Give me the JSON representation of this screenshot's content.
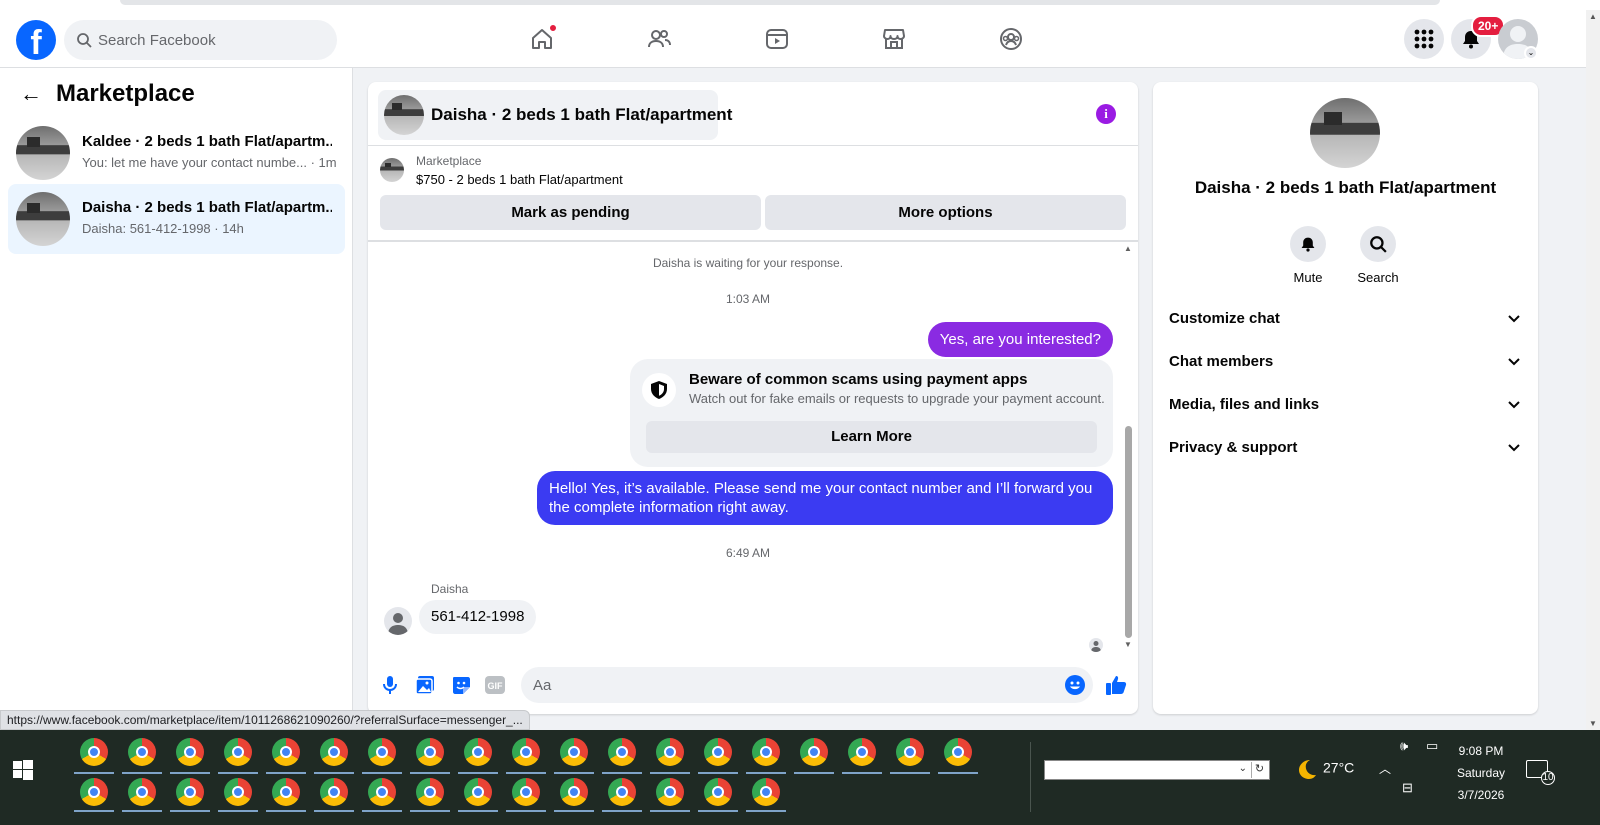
{
  "header": {
    "search_placeholder": "Search Facebook",
    "nav": [
      "home-icon",
      "friends-icon",
      "video-icon",
      "marketplace-icon",
      "groups-icon"
    ],
    "notifications_badge": "20+",
    "colors": {
      "brand": "#0866ff",
      "badge": "#e41e3f"
    }
  },
  "sidebar": {
    "title": "Marketplace",
    "conversations": [
      {
        "name": "Kaldee · 2 beds 1 bath Flat/apartm...",
        "preview": "You: let me have your contact numbe... · 1m"
      },
      {
        "name": "Daisha · 2 beds 1 bath Flat/apartm...",
        "preview": "Daisha: 561-412-1998 · 14h"
      }
    ]
  },
  "chat": {
    "title": "Daisha · 2 beds 1 bath Flat/apartment",
    "listing_source": "Marketplace",
    "listing_price": "$750 - 2 beds 1 bath Flat/apartment",
    "mark_pending_label": "Mark as pending",
    "more_options_label": "More options",
    "waiting_text": "Daisha is waiting for your response.",
    "time_1": "1:03 AM",
    "msg_out_1": "Yes, are you interested?",
    "scam_title": "Beware of common scams using payment apps",
    "scam_desc": "Watch out for fake emails or requests to upgrade your payment account.",
    "learn_more": "Learn More",
    "msg_out_2": "Hello! Yes, it’s available. Please send me your contact number and I’ll forward you the complete information right away.",
    "time_2": "6:49 AM",
    "sender_name": "Daisha",
    "msg_in_1": "561-412-1998",
    "composer_placeholder": "Aa",
    "colors": {
      "outgoing_purple": "#8a2be2",
      "outgoing_blue": "#3b3bf2",
      "accent": "#0866ff"
    }
  },
  "details": {
    "title": "Daisha · 2 beds 1 bath Flat/apartment",
    "mute_label": "Mute",
    "search_label": "Search",
    "sections": [
      "Customize chat",
      "Chat members",
      "Media, files and links",
      "Privacy & support"
    ]
  },
  "status_url": "https://www.facebook.com/marketplace/item/1011268621090260/?referralSurface=messenger_...",
  "taskbar": {
    "temperature": "27°C",
    "time": "9:08 PM",
    "day": "Saturday",
    "date": "3/7/2026",
    "notifications": "10"
  }
}
